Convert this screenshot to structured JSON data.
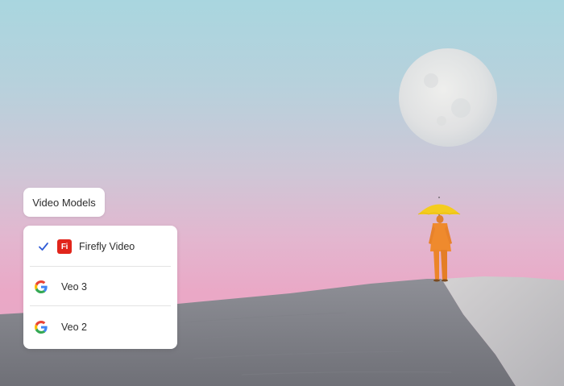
{
  "panel": {
    "title": "Video Models"
  },
  "models": [
    {
      "label": "Firefly Video",
      "selected": true,
      "icon": "firefly-icon",
      "icon_text": "Fi"
    },
    {
      "label": "Veo 3",
      "selected": false,
      "icon": "google-g-icon"
    },
    {
      "label": "Veo 2",
      "selected": false,
      "icon": "google-g-icon"
    }
  ],
  "colors": {
    "firefly_red": "#e1251b",
    "check_blue": "#2f5bd6",
    "umbrella_yellow": "#f4cc1f",
    "suit_orange": "#ef8a2d"
  }
}
